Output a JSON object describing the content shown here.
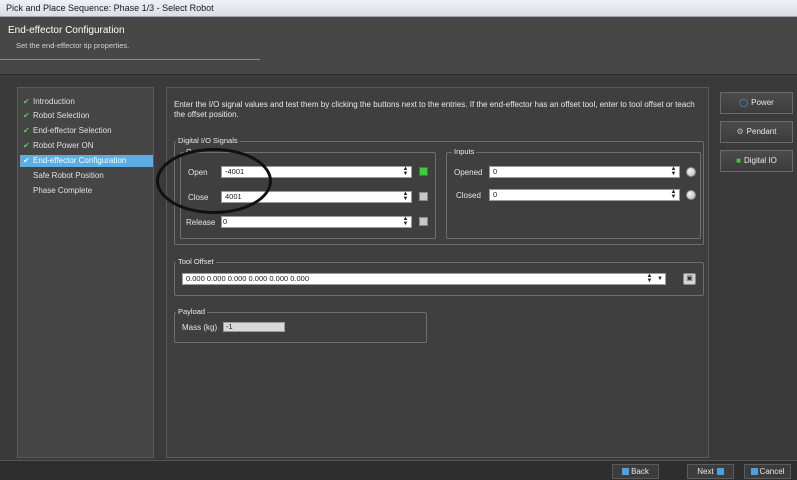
{
  "window": {
    "title": "Pick and Place Sequence: Phase 1/3 - Select Robot"
  },
  "header": {
    "title": "End-effector Configuration",
    "subtitle": "Set the end-effector tip properties."
  },
  "sidebar": {
    "items": [
      {
        "label": "Introduction",
        "checked": true
      },
      {
        "label": "Robot Selection",
        "checked": true
      },
      {
        "label": "End-effector Selection",
        "checked": true
      },
      {
        "label": "Robot Power ON",
        "checked": true
      },
      {
        "label": "End-effector Configuration",
        "checked": true,
        "active": true
      },
      {
        "label": "Safe Robot Position",
        "checked": false
      },
      {
        "label": "Phase Complete",
        "checked": false
      }
    ]
  },
  "instructions": "Enter the I/O signal values and test them by clicking the buttons next to the entries. If the end-effector has an offset tool, enter to tool offset or teach the offset position.",
  "digital_io": {
    "group_label": "Digital I/O Signals",
    "outputs": {
      "group_label": "O",
      "open_label": "Open",
      "open_value": "-4001",
      "close_label": "Close",
      "close_value": "4001",
      "release_label": "Release",
      "release_value": "0"
    },
    "inputs": {
      "group_label": "Inputs",
      "opened_label": "Opened",
      "opened_value": "0",
      "closed_label": "Closed",
      "closed_value": "0"
    }
  },
  "tool_offset": {
    "group_label": "Tool Offset",
    "value": "0.000 0.000 0.000 0.000 0.000 0.000"
  },
  "payload": {
    "group_label": "Payload",
    "mass_label": "Mass (kg)",
    "mass_value": "-1"
  },
  "right_panel": {
    "power": "Power",
    "pendant": "Pendant",
    "digital_io": "Digital IO"
  },
  "footer": {
    "back": "Back",
    "next": "Next",
    "cancel": "Cancel"
  },
  "colors": {
    "accent": "#5aaee6",
    "led_on": "#3dcc3d",
    "led_off": "#c8c8c8"
  }
}
